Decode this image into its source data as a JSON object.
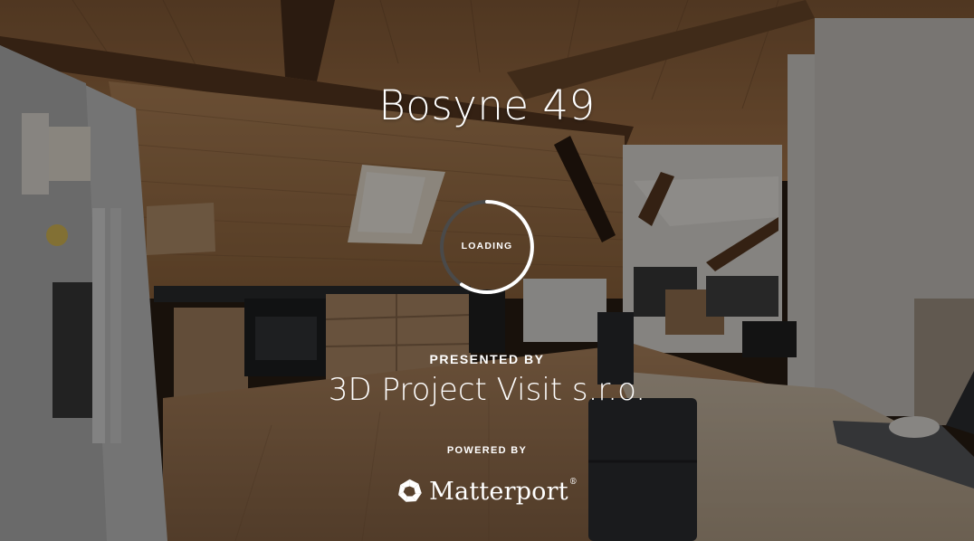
{
  "tour": {
    "title": "Bosyne 49",
    "loading_label": "LOADING",
    "presented_by_label": "PRESENTED BY",
    "presenter_name": "3D Project Visit s.r.o.",
    "powered_by_label": "POWERED BY",
    "brand_name": "Matterport",
    "brand_logo_icon": "matterport-logo-icon"
  },
  "colors": {
    "text": "#ffffff",
    "spinner_track": "#4a4a4a",
    "spinner_progress": "#ffffff",
    "dim_overlay": "rgba(0,0,0,0.42)"
  }
}
